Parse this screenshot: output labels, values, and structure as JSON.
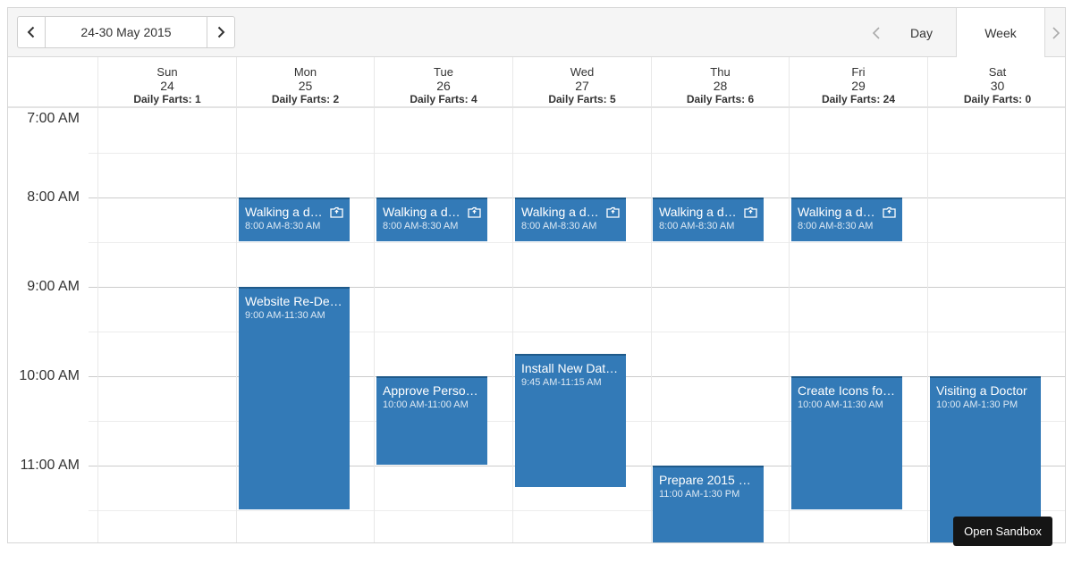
{
  "toolbar": {
    "date_range": "24-30 May 2015",
    "views": {
      "day": "Day",
      "week": "Week"
    },
    "active_view": "Week"
  },
  "days": [
    {
      "name": "Sun",
      "date": "24",
      "stat": "Daily Farts: 1"
    },
    {
      "name": "Mon",
      "date": "25",
      "stat": "Daily Farts: 2"
    },
    {
      "name": "Tue",
      "date": "26",
      "stat": "Daily Farts: 4"
    },
    {
      "name": "Wed",
      "date": "27",
      "stat": "Daily Farts: 5"
    },
    {
      "name": "Thu",
      "date": "28",
      "stat": "Daily Farts: 6"
    },
    {
      "name": "Fri",
      "date": "29",
      "stat": "Daily Farts: 24"
    },
    {
      "name": "Sat",
      "date": "30",
      "stat": "Daily Farts: 0"
    }
  ],
  "times": [
    "7:00 AM",
    "8:00 AM",
    "9:00 AM",
    "10:00 AM",
    "11:00 AM"
  ],
  "events": [
    {
      "title": "Walking a dog",
      "time": "8:00 AM-8:30 AM",
      "recurring": true
    },
    {
      "title": "Walking a dog",
      "time": "8:00 AM-8:30 AM",
      "recurring": true
    },
    {
      "title": "Walking a dog",
      "time": "8:00 AM-8:30 AM",
      "recurring": true
    },
    {
      "title": "Walking a dog",
      "time": "8:00 AM-8:30 AM",
      "recurring": true
    },
    {
      "title": "Walking a dog",
      "time": "8:00 AM-8:30 AM",
      "recurring": true
    },
    {
      "title": "Website Re-Des...",
      "time": "9:00 AM-11:30 AM",
      "recurring": false
    },
    {
      "title": "Approve Person...",
      "time": "10:00 AM-11:00 AM",
      "recurring": false
    },
    {
      "title": "Install New Data...",
      "time": "9:45 AM-11:15 AM",
      "recurring": false
    },
    {
      "title": "Prepare 2015 M...",
      "time": "11:00 AM-1:30 PM",
      "recurring": false
    },
    {
      "title": "Create Icons for...",
      "time": "10:00 AM-11:30 AM",
      "recurring": false
    },
    {
      "title": "Visiting a Doctor",
      "time": "10:00 AM-1:30 PM",
      "recurring": false
    }
  ],
  "sandbox_label": "Open Sandbox",
  "colors": {
    "event": "#337ab7",
    "event_border": "#1f5a8a",
    "toolbar": "#f5f5f5"
  }
}
